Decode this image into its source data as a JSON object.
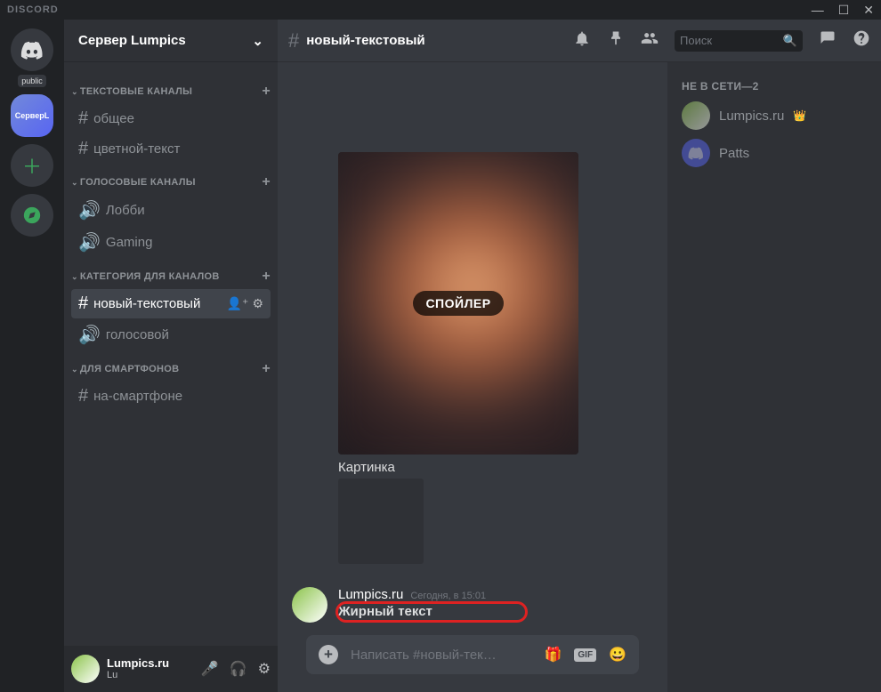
{
  "titlebar": {
    "wordmark": "DISCORD"
  },
  "servers": {
    "public_badge": "public",
    "active_label": "СерверL"
  },
  "sidebar": {
    "server_name": "Сервер Lumpics",
    "cats": [
      {
        "label": "ТЕКСТОВЫЕ КАНАЛЫ",
        "channels": [
          {
            "name": "общее",
            "type": "text"
          },
          {
            "name": "цветной-текст",
            "type": "text"
          }
        ]
      },
      {
        "label": "ГОЛОСОВЫЕ КАНАЛЫ",
        "channels": [
          {
            "name": "Лобби",
            "type": "voice"
          },
          {
            "name": "Gaming",
            "type": "voice"
          }
        ]
      },
      {
        "label": "КАТЕГОРИЯ ДЛЯ КАНАЛОВ",
        "channels": [
          {
            "name": "новый-текстовый",
            "type": "text",
            "active": true
          },
          {
            "name": "голосовой",
            "type": "voice"
          }
        ]
      },
      {
        "label": "ДЛЯ СМАРТФОНОВ",
        "channels": [
          {
            "name": "на-смартфоне",
            "type": "text"
          }
        ]
      }
    ]
  },
  "userpanel": {
    "name": "Lumpics.ru",
    "disc": "Lu"
  },
  "header": {
    "channel": "новый-текстовый",
    "search_placeholder": "Поиск"
  },
  "messages": {
    "spoiler_label": "СПОЙЛЕР",
    "caption": "Картинка",
    "msg": {
      "user": "Lumpics.ru",
      "time": "Сегодня, в 15:01",
      "content": "Жирный текст"
    }
  },
  "compose": {
    "placeholder": "Написать #новый-тек…",
    "gif": "GIF"
  },
  "members": {
    "header": "НЕ В СЕТИ—2",
    "items": [
      {
        "name": "Lumpics.ru",
        "owner": true
      },
      {
        "name": "Patts"
      }
    ]
  }
}
